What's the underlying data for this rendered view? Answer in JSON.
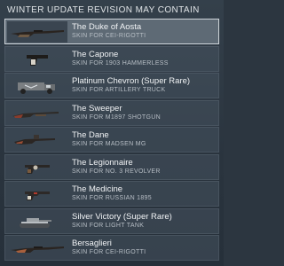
{
  "header": {
    "title": "WINTER UPDATE REVISION MAY CONTAIN"
  },
  "items": [
    {
      "name": "The Duke of Aosta",
      "subtitle": "SKIN FOR CEI-RIGOTTI",
      "icon": "rifle-icon"
    },
    {
      "name": "The Capone",
      "subtitle": "SKIN FOR 1903 HAMMERLESS",
      "icon": "pistol-icon"
    },
    {
      "name": "Platinum Chevron (Super Rare)",
      "subtitle": "SKIN FOR ARTILLERY TRUCK",
      "icon": "truck-icon"
    },
    {
      "name": "The Sweeper",
      "subtitle": "SKIN FOR M1897 SHOTGUN",
      "icon": "shotgun-icon"
    },
    {
      "name": "The Dane",
      "subtitle": "SKIN FOR MADSEN MG",
      "icon": "machine-gun-icon"
    },
    {
      "name": "The Legionnaire",
      "subtitle": "SKIN FOR NO. 3 REVOLVER",
      "icon": "revolver-icon"
    },
    {
      "name": "The Medicine",
      "subtitle": "SKIN FOR RUSSIAN 1895",
      "icon": "revolver-icon"
    },
    {
      "name": "Silver Victory (Super Rare)",
      "subtitle": "SKIN FOR LIGHT TANK",
      "icon": "tank-icon"
    },
    {
      "name": "Bersaglieri",
      "subtitle": "SKIN FOR CEI-RIGOTTI",
      "icon": "rifle-icon"
    }
  ]
}
